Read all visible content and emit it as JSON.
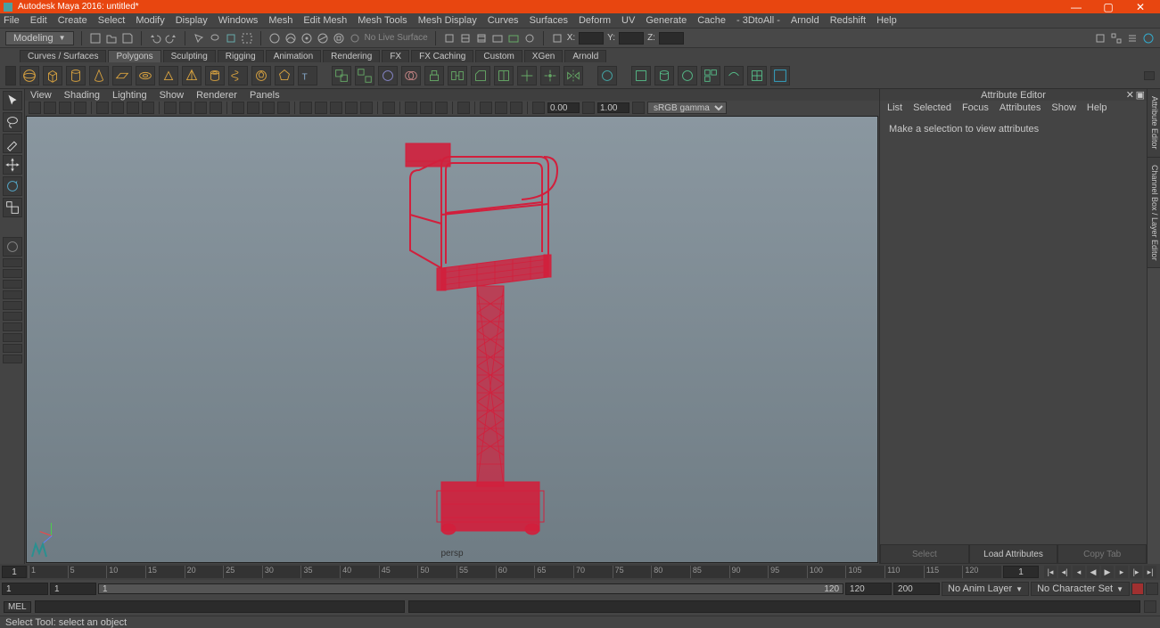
{
  "title": "Autodesk Maya 2016: untitled*",
  "menu": [
    "File",
    "Edit",
    "Create",
    "Select",
    "Modify",
    "Display",
    "Windows",
    "Mesh",
    "Edit Mesh",
    "Mesh Tools",
    "Mesh Display",
    "Curves",
    "Surfaces",
    "Deform",
    "UV",
    "Generate",
    "Cache",
    "- 3DtoAll -",
    "Arnold",
    "Redshift",
    "Help"
  ],
  "workspace": "Modeling",
  "liveSurface": "No Live Surface",
  "coords": {
    "xLabel": "X:",
    "yLabel": "Y:",
    "zLabel": "Z:",
    "x": "",
    "y": "",
    "z": ""
  },
  "shelfTabs": [
    "Curves / Surfaces",
    "Polygons",
    "Sculpting",
    "Rigging",
    "Animation",
    "Rendering",
    "FX",
    "FX Caching",
    "Custom",
    "XGen",
    "Arnold"
  ],
  "activeShelf": "Polygons",
  "panelMenu": [
    "View",
    "Shading",
    "Lighting",
    "Show",
    "Renderer",
    "Panels"
  ],
  "exposure": "0.00",
  "gamma": "1.00",
  "colorSpace": "sRGB gamma",
  "cameraName": "persp",
  "attrEditor": {
    "title": "Attribute Editor",
    "menu": [
      "List",
      "Selected",
      "Focus",
      "Attributes",
      "Show",
      "Help"
    ],
    "msg": "Make a selection to view attributes",
    "btns": {
      "select": "Select",
      "load": "Load Attributes",
      "copy": "Copy Tab"
    }
  },
  "sideTabs": [
    "Attribute Editor",
    "Channel Box / Layer Editor"
  ],
  "time": {
    "current": "1",
    "ticks": [
      "1",
      "5",
      "10",
      "15",
      "20",
      "25",
      "30",
      "35",
      "40",
      "45",
      "50",
      "55",
      "60",
      "65",
      "70",
      "75",
      "80",
      "85",
      "90",
      "95",
      "100",
      "105",
      "110",
      "115",
      "120"
    ],
    "rangeStart1": "1",
    "rangeStart2": "1",
    "rangeInner1": "1",
    "rangeInner2": "120",
    "rangeEnd1": "120",
    "rangeEnd2": "200",
    "animLayer": "No Anim Layer",
    "charSet": "No Character Set"
  },
  "mel": "MEL",
  "helpline": "Select Tool: select an object"
}
